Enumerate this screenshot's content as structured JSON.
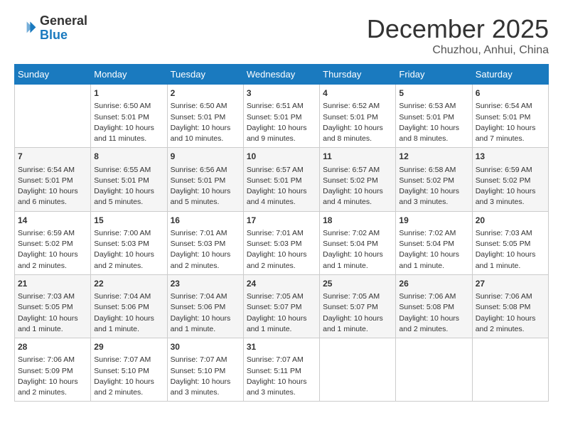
{
  "header": {
    "logo_line1": "General",
    "logo_line2": "Blue",
    "month": "December 2025",
    "location": "Chuzhou, Anhui, China"
  },
  "weekdays": [
    "Sunday",
    "Monday",
    "Tuesday",
    "Wednesday",
    "Thursday",
    "Friday",
    "Saturday"
  ],
  "weeks": [
    [
      {
        "day": "",
        "info": ""
      },
      {
        "day": "1",
        "info": "Sunrise: 6:50 AM\nSunset: 5:01 PM\nDaylight: 10 hours\nand 11 minutes."
      },
      {
        "day": "2",
        "info": "Sunrise: 6:50 AM\nSunset: 5:01 PM\nDaylight: 10 hours\nand 10 minutes."
      },
      {
        "day": "3",
        "info": "Sunrise: 6:51 AM\nSunset: 5:01 PM\nDaylight: 10 hours\nand 9 minutes."
      },
      {
        "day": "4",
        "info": "Sunrise: 6:52 AM\nSunset: 5:01 PM\nDaylight: 10 hours\nand 8 minutes."
      },
      {
        "day": "5",
        "info": "Sunrise: 6:53 AM\nSunset: 5:01 PM\nDaylight: 10 hours\nand 8 minutes."
      },
      {
        "day": "6",
        "info": "Sunrise: 6:54 AM\nSunset: 5:01 PM\nDaylight: 10 hours\nand 7 minutes."
      }
    ],
    [
      {
        "day": "7",
        "info": "Sunrise: 6:54 AM\nSunset: 5:01 PM\nDaylight: 10 hours\nand 6 minutes."
      },
      {
        "day": "8",
        "info": "Sunrise: 6:55 AM\nSunset: 5:01 PM\nDaylight: 10 hours\nand 5 minutes."
      },
      {
        "day": "9",
        "info": "Sunrise: 6:56 AM\nSunset: 5:01 PM\nDaylight: 10 hours\nand 5 minutes."
      },
      {
        "day": "10",
        "info": "Sunrise: 6:57 AM\nSunset: 5:01 PM\nDaylight: 10 hours\nand 4 minutes."
      },
      {
        "day": "11",
        "info": "Sunrise: 6:57 AM\nSunset: 5:02 PM\nDaylight: 10 hours\nand 4 minutes."
      },
      {
        "day": "12",
        "info": "Sunrise: 6:58 AM\nSunset: 5:02 PM\nDaylight: 10 hours\nand 3 minutes."
      },
      {
        "day": "13",
        "info": "Sunrise: 6:59 AM\nSunset: 5:02 PM\nDaylight: 10 hours\nand 3 minutes."
      }
    ],
    [
      {
        "day": "14",
        "info": "Sunrise: 6:59 AM\nSunset: 5:02 PM\nDaylight: 10 hours\nand 2 minutes."
      },
      {
        "day": "15",
        "info": "Sunrise: 7:00 AM\nSunset: 5:03 PM\nDaylight: 10 hours\nand 2 minutes."
      },
      {
        "day": "16",
        "info": "Sunrise: 7:01 AM\nSunset: 5:03 PM\nDaylight: 10 hours\nand 2 minutes."
      },
      {
        "day": "17",
        "info": "Sunrise: 7:01 AM\nSunset: 5:03 PM\nDaylight: 10 hours\nand 2 minutes."
      },
      {
        "day": "18",
        "info": "Sunrise: 7:02 AM\nSunset: 5:04 PM\nDaylight: 10 hours\nand 1 minute."
      },
      {
        "day": "19",
        "info": "Sunrise: 7:02 AM\nSunset: 5:04 PM\nDaylight: 10 hours\nand 1 minute."
      },
      {
        "day": "20",
        "info": "Sunrise: 7:03 AM\nSunset: 5:05 PM\nDaylight: 10 hours\nand 1 minute."
      }
    ],
    [
      {
        "day": "21",
        "info": "Sunrise: 7:03 AM\nSunset: 5:05 PM\nDaylight: 10 hours\nand 1 minute."
      },
      {
        "day": "22",
        "info": "Sunrise: 7:04 AM\nSunset: 5:06 PM\nDaylight: 10 hours\nand 1 minute."
      },
      {
        "day": "23",
        "info": "Sunrise: 7:04 AM\nSunset: 5:06 PM\nDaylight: 10 hours\nand 1 minute."
      },
      {
        "day": "24",
        "info": "Sunrise: 7:05 AM\nSunset: 5:07 PM\nDaylight: 10 hours\nand 1 minute."
      },
      {
        "day": "25",
        "info": "Sunrise: 7:05 AM\nSunset: 5:07 PM\nDaylight: 10 hours\nand 1 minute."
      },
      {
        "day": "26",
        "info": "Sunrise: 7:06 AM\nSunset: 5:08 PM\nDaylight: 10 hours\nand 2 minutes."
      },
      {
        "day": "27",
        "info": "Sunrise: 7:06 AM\nSunset: 5:08 PM\nDaylight: 10 hours\nand 2 minutes."
      }
    ],
    [
      {
        "day": "28",
        "info": "Sunrise: 7:06 AM\nSunset: 5:09 PM\nDaylight: 10 hours\nand 2 minutes."
      },
      {
        "day": "29",
        "info": "Sunrise: 7:07 AM\nSunset: 5:10 PM\nDaylight: 10 hours\nand 2 minutes."
      },
      {
        "day": "30",
        "info": "Sunrise: 7:07 AM\nSunset: 5:10 PM\nDaylight: 10 hours\nand 3 minutes."
      },
      {
        "day": "31",
        "info": "Sunrise: 7:07 AM\nSunset: 5:11 PM\nDaylight: 10 hours\nand 3 minutes."
      },
      {
        "day": "",
        "info": ""
      },
      {
        "day": "",
        "info": ""
      },
      {
        "day": "",
        "info": ""
      }
    ]
  ]
}
